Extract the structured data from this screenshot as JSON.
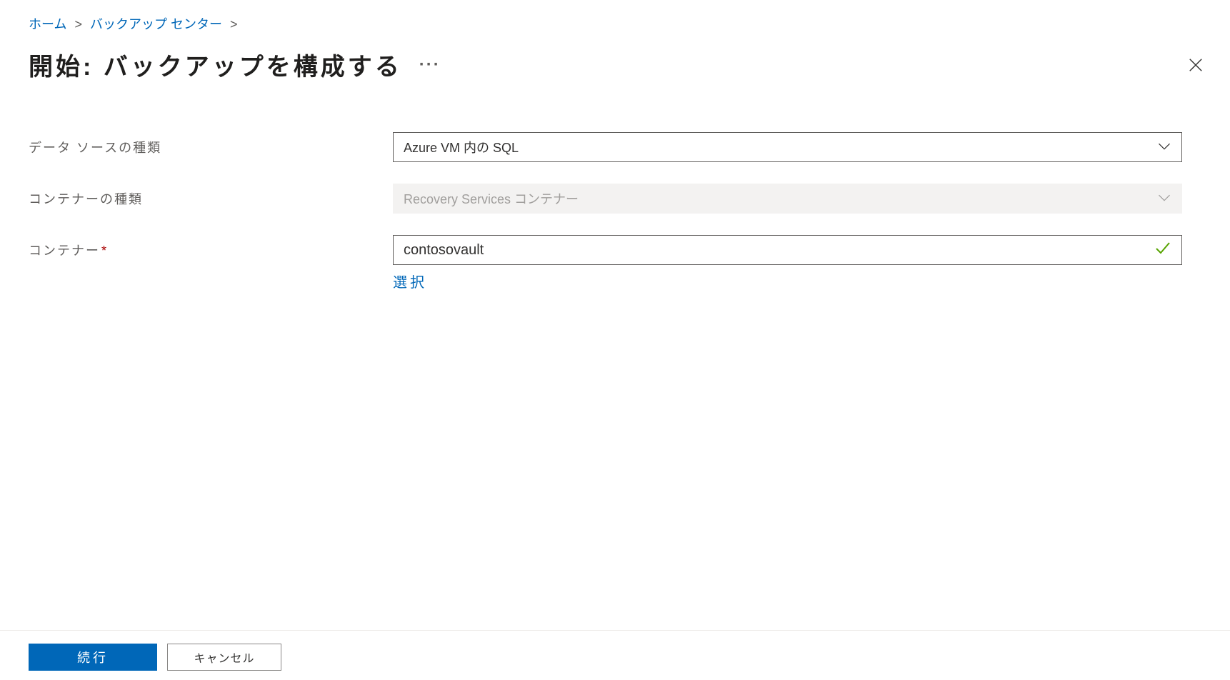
{
  "breadcrumb": {
    "items": [
      {
        "label": "ホーム"
      },
      {
        "label": "バックアップ センター"
      }
    ]
  },
  "header": {
    "title": "開始: バックアップを構成する"
  },
  "form": {
    "datasource": {
      "label": "データ ソースの種類",
      "value": "Azure VM 内の SQL"
    },
    "container_type": {
      "label": "コンテナーの種類",
      "value": "Recovery Services コンテナー"
    },
    "container": {
      "label": "コンテナー",
      "required": "*",
      "value": "contosovault",
      "select_link": "選択"
    }
  },
  "footer": {
    "primary": "続行",
    "secondary": "キャンセル"
  }
}
